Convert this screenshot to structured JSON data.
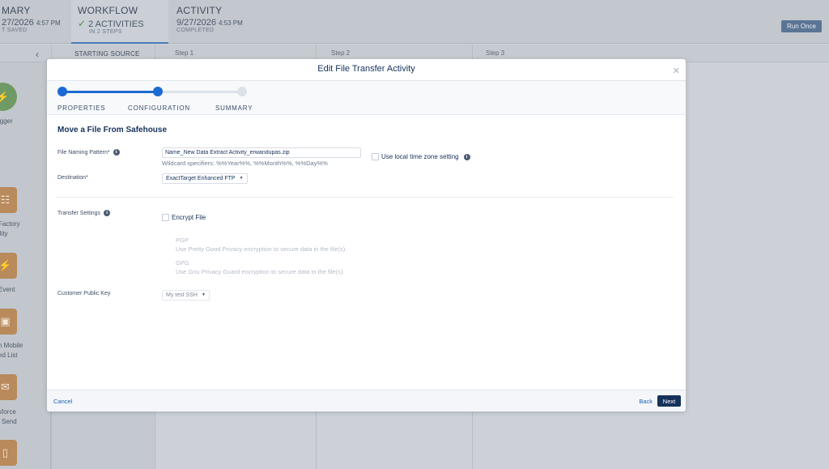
{
  "background": {
    "summary": {
      "title": "MARY",
      "date": "27/2026",
      "time": "4:57 PM",
      "caption": "T SAVED"
    },
    "workflow": {
      "title": "WORKFLOW",
      "activities": "2 ACTIVITIES",
      "caption": "IN 2 STEPS"
    },
    "activity": {
      "title": "ACTIVITY",
      "date": "9/27/2026",
      "time": "4:53 PM",
      "caption": "COMPLETED"
    },
    "run_once": "Run Once",
    "columns": {
      "source": "STARTING SOURCE",
      "step1": "Step 1",
      "step2": "Step 2",
      "step3": "Step 3"
    },
    "palette": [
      {
        "label": "igger",
        "icon": "lightning-icon"
      },
      {
        "label": "Factory\nility",
        "icon": "list-icon"
      },
      {
        "label": "Event",
        "icon": "lightning-icon"
      },
      {
        "label": "n Mobile\ned List",
        "icon": "mobile-icon"
      },
      {
        "label": "sforce\nl Send",
        "icon": "email-icon"
      },
      {
        "label": "",
        "icon": "phone-icon"
      }
    ]
  },
  "modal": {
    "title": "Edit File Transfer Activity",
    "steps": [
      {
        "label": "PROPERTIES",
        "state": "complete"
      },
      {
        "label": "CONFIGURATION",
        "state": "active"
      },
      {
        "label": "SUMMARY",
        "state": "upcoming"
      }
    ],
    "section_title": "Move a File From Safehouse",
    "file_naming": {
      "label": "File Naming Pattern*",
      "value": "Name_New Data Extract Activity_erwandupas.zip",
      "hint": "Wildcard specifiers: %%Year%%, %%Month%%, %%Day%%"
    },
    "local_timezone_label": "Use local time zone setting",
    "destination": {
      "label": "Destination*",
      "value": "ExactTarget Enhanced FTP"
    },
    "transfer_settings": {
      "label": "Transfer Settings",
      "encrypt_label": "Encrypt File",
      "options": [
        {
          "title": "PGP",
          "desc": "Use Pretty Good Privacy encryption to secure data in the file(s)."
        },
        {
          "title": "GPG",
          "desc": "Use Gnu Privacy Guard encryption to secure data in the file(s)."
        }
      ]
    },
    "public_key": {
      "label": "Customer Public Key",
      "value": "My test SSH"
    },
    "footer": {
      "cancel": "Cancel",
      "back": "Back",
      "next": "Next"
    }
  },
  "colors": {
    "accent": "#1b6ad3",
    "primary_dark": "#16325c",
    "tile_orange": "#b88a5c",
    "tile_green": "#6f9a66"
  }
}
